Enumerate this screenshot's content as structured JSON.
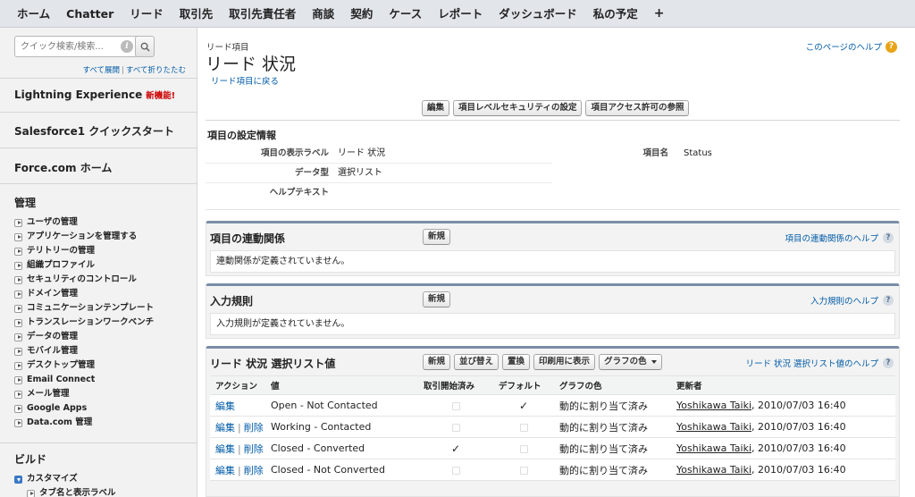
{
  "tabs": [
    "ホーム",
    "Chatter",
    "リード",
    "取引先",
    "取引先責任者",
    "商談",
    "契約",
    "ケース",
    "レポート",
    "ダッシュボード",
    "私の予定",
    "+"
  ],
  "sidebar": {
    "search_placeholder": "クイック検索/検索...",
    "expand_all": "すべて展開",
    "collapse_all": "すべて折りたたむ",
    "sep": "|",
    "lightning": "Lightning Experience",
    "lightning_badge": "新機能!",
    "quickstart": "Salesforce1 クイックスタート",
    "forcecom": "Force.com ホーム",
    "admin_title": "管理",
    "admin_items": [
      "ユーザの管理",
      "アプリケーションを管理する",
      "テリトリーの管理",
      "組織プロファイル",
      "セキュリティのコントロール",
      "ドメイン管理",
      "コミュニケーションテンプレート",
      "トランスレーションワークベンチ",
      "データの管理",
      "モバイル管理",
      "デスクトップ管理",
      "Email Connect",
      "メール管理",
      "Google Apps",
      "Data.com 管理"
    ],
    "build_title": "ビルド",
    "customize": "カスタマイズ",
    "tab_names": "タブ名と表示ラベル"
  },
  "header": {
    "crumb": "リード項目",
    "title": "リード 状況",
    "back_link": "リード項目に戻る",
    "page_help": "このページのヘルプ"
  },
  "buttons": {
    "edit": "編集",
    "field_security": "項目レベルセキュリティの設定",
    "field_access": "項目アクセス許可の参照"
  },
  "detail": {
    "section_title": "項目の設定情報",
    "label_label": "項目の表示ラベル",
    "label_value": "リード 状況",
    "name_label": "項目名",
    "name_value": "Status",
    "type_label": "データ型",
    "type_value": "選択リスト",
    "help_label": "ヘルプテキスト"
  },
  "dependencies": {
    "title": "項目の連動関係",
    "new": "新規",
    "help": "項目の連動関係のヘルプ",
    "empty": "連動関係が定義されていません。"
  },
  "validation": {
    "title": "入力規則",
    "new": "新規",
    "help": "入力規則のヘルプ",
    "empty": "入力規則が定義されていません。"
  },
  "picklist": {
    "title": "リード 状況 選択リスト値",
    "buttons": [
      "新規",
      "並び替え",
      "置換",
      "印刷用に表示"
    ],
    "graph_dropdown": "グラフの色",
    "help": "リード 状況 選択リスト値のヘルプ",
    "columns": [
      "アクション",
      "値",
      "取引開始済み",
      "デフォルト",
      "グラフの色",
      "更新者"
    ],
    "edit": "編集",
    "delete": "削除",
    "rows": [
      {
        "value": "Open - Not Contacted",
        "converted": false,
        "default": true,
        "graph": "動的に割り当て済み",
        "user": "Yoshikawa Taiki",
        "date": ", 2010/07/03 16:40",
        "can_delete": false
      },
      {
        "value": "Working - Contacted",
        "converted": false,
        "default": false,
        "graph": "動的に割り当て済み",
        "user": "Yoshikawa Taiki",
        "date": ", 2010/07/03 16:40",
        "can_delete": true
      },
      {
        "value": "Closed - Converted",
        "converted": true,
        "default": false,
        "graph": "動的に割り当て済み",
        "user": "Yoshikawa Taiki",
        "date": ", 2010/07/03 16:40",
        "can_delete": true
      },
      {
        "value": "Closed - Not Converted",
        "converted": false,
        "default": false,
        "graph": "動的に割り当て済み",
        "user": "Yoshikawa Taiki",
        "date": ", 2010/07/03 16:40",
        "can_delete": true
      }
    ]
  },
  "help_glyph": "?",
  "check_glyph": "✓",
  "colors": {
    "link": "#015ba7",
    "panel_border": "#7a8da6",
    "new_badge": "#cc0000",
    "help_orange": "#e8a317"
  }
}
